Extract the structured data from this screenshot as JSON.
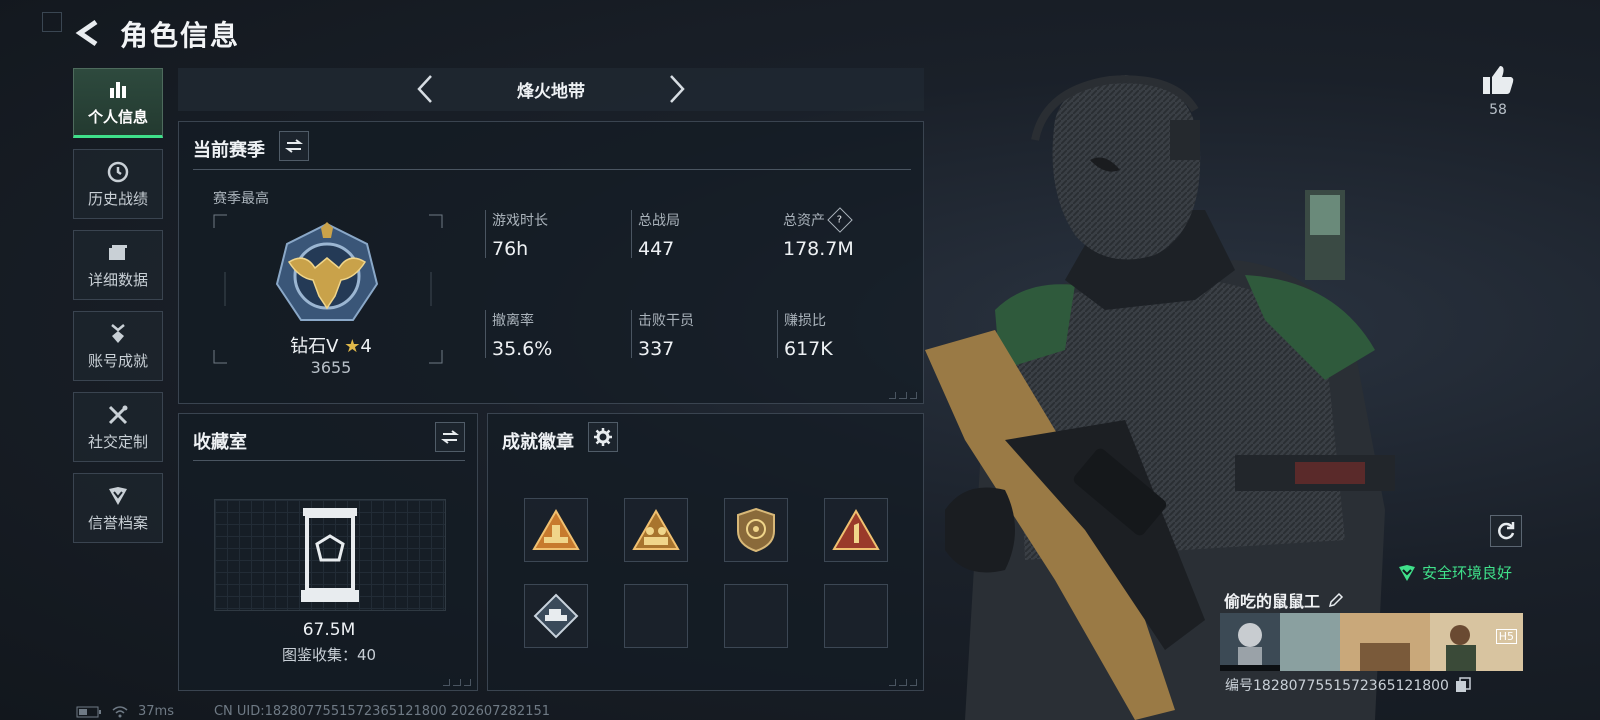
{
  "header": {
    "title": "角色信息"
  },
  "nav": {
    "items": [
      {
        "label": "个人信息",
        "icon": "bar-chart-icon",
        "active": true
      },
      {
        "label": "历史战绩",
        "icon": "history-icon"
      },
      {
        "label": "详细数据",
        "icon": "folder-icon"
      },
      {
        "label": "账号成就",
        "icon": "medal-icon"
      },
      {
        "label": "社交定制",
        "icon": "tools-icon"
      },
      {
        "label": "信誉档案",
        "icon": "shield-icon"
      }
    ]
  },
  "mode": {
    "title": "烽火地带"
  },
  "season": {
    "title": "当前赛季",
    "peak_label": "赛季最高",
    "rank_name": "钻石V",
    "rank_stars": "4",
    "rank_points": "3655",
    "stats": [
      {
        "label": "游戏时长",
        "value": "76h"
      },
      {
        "label": "总战局",
        "value": "447"
      },
      {
        "label": "总资产",
        "value": "178.7M",
        "help": "?"
      },
      {
        "label": "撤离率",
        "value": "35.6%"
      },
      {
        "label": "击败干员",
        "value": "337"
      },
      {
        "label": "赚损比",
        "value": "617K"
      }
    ]
  },
  "collection": {
    "title": "收藏室",
    "value": "67.5M",
    "count_text": "图鉴收集：40"
  },
  "achievements": {
    "title": "成就徽章",
    "badges": [
      "badge-triangle-bars-icon",
      "badge-triangle-soldiers-icon",
      "badge-shield-icon",
      "badge-triangle-one-icon",
      "badge-diamond-vehicle-icon",
      "",
      "",
      ""
    ]
  },
  "profile": {
    "likes": "58",
    "env_status": "安全环境良好",
    "player_name": "偷吃的鼠鼠工",
    "player_id": "编号1828077551572365121800",
    "banner_tag": "H5"
  },
  "status_bar": {
    "ping": "37ms",
    "uid_text": "CN UID:1828077551572365121800 202607282151"
  },
  "colors": {
    "accent_green": "#3fe08a",
    "panel_bg": "#141c24",
    "gold": "#c9a24a"
  }
}
